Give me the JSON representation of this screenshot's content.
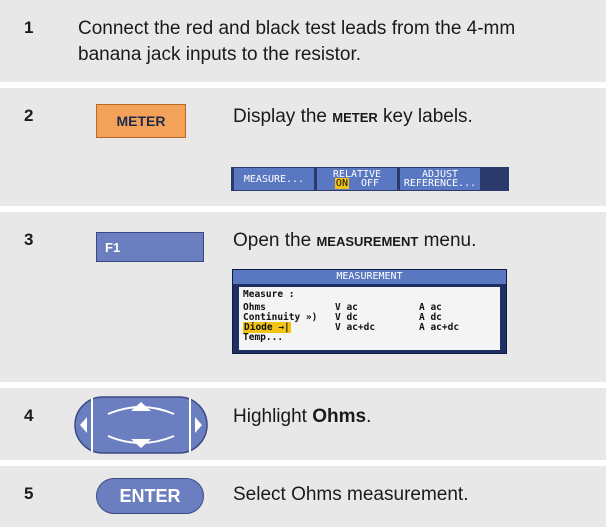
{
  "steps": [
    {
      "num": "1",
      "text": "Connect the red and black test leads from the 4-mm banana jack inputs to the resistor."
    },
    {
      "num": "2",
      "button": "METER",
      "text_pre": "Display the ",
      "text_key": "METER",
      "text_post": " key labels.",
      "softkeys": [
        {
          "lines": [
            "MEASURE..."
          ]
        },
        {
          "lines": [
            "RELATIVE"
          ],
          "on": "ON",
          "off": "OFF"
        },
        {
          "lines": [
            "ADJUST",
            "REFERENCE..."
          ]
        }
      ]
    },
    {
      "num": "3",
      "button": "F1",
      "text_pre": "Open the ",
      "text_key": "MEASUREMENT",
      "text_post": " menu.",
      "menu": {
        "title": "MEASUREMENT",
        "heading": "Measure :",
        "col1": [
          "Ohms",
          "Continuity »)",
          "Diode →|",
          "Temp..."
        ],
        "col2": [
          "V ac",
          "V dc",
          "V ac+dc"
        ],
        "col3": [
          "A ac",
          "A dc",
          "A ac+dc"
        ]
      }
    },
    {
      "num": "4",
      "text_pre": "Highlight ",
      "text_key": "Ohms",
      "text_post": "."
    },
    {
      "num": "5",
      "button": "ENTER",
      "text": "Select Ohms measurement."
    }
  ]
}
